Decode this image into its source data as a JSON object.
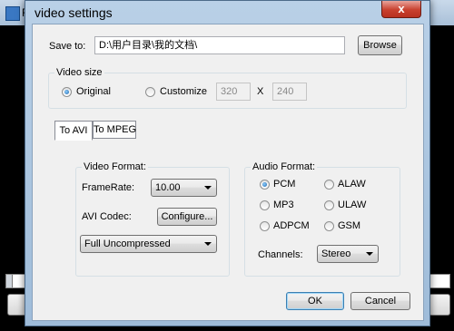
{
  "background": {
    "app_title": "F"
  },
  "dialog": {
    "title": "video settings",
    "close_label": "x"
  },
  "save": {
    "label": "Save to:",
    "path": "D:\\用户目录\\我的文档\\",
    "browse_label": "Browse"
  },
  "video_size": {
    "group_title": "Video size",
    "original_label": "Original",
    "customize_label": "Customize",
    "selected": "original",
    "width": "320",
    "height": "240",
    "separator": "X"
  },
  "tabs": [
    {
      "label": "To AVI",
      "active": true
    },
    {
      "label": "To MPEG",
      "active": false
    }
  ],
  "video_format": {
    "group_title": "Video Format:",
    "framerate_label": "FrameRate:",
    "framerate_value": "10.00",
    "codec_label": "AVI Codec:",
    "configure_label": "Configure...",
    "codec_value": "Full Uncompressed"
  },
  "audio_format": {
    "group_title": "Audio Format:",
    "options": [
      "PCM",
      "ALAW",
      "MP3",
      "ULAW",
      "ADPCM",
      "GSM"
    ],
    "selected": "PCM",
    "channels_label": "Channels:",
    "channels_value": "Stereo"
  },
  "footer": {
    "ok_label": "OK",
    "cancel_label": "Cancel"
  },
  "colors": {
    "title_bar": "#b9d0e7",
    "close_button": "#c8402e",
    "dialog_face": "#f0f0f0"
  }
}
